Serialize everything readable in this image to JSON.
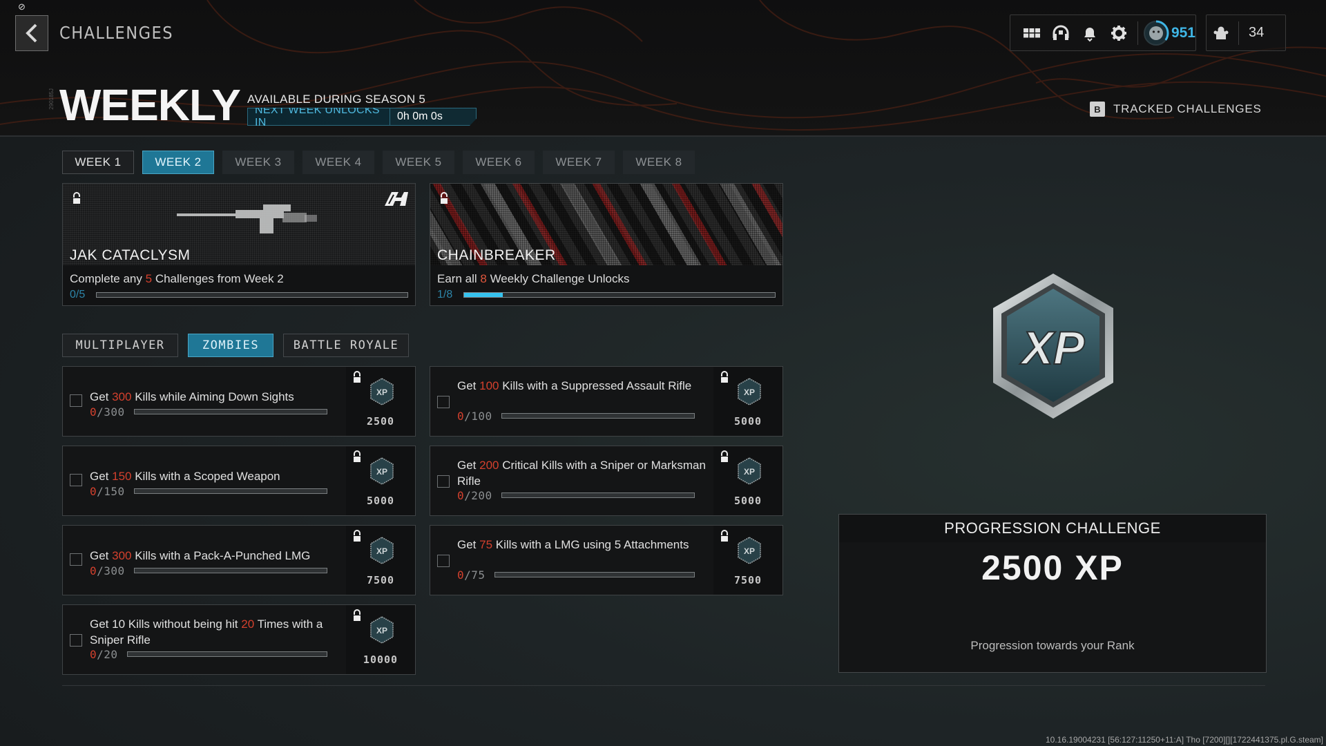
{
  "header": {
    "breadcrumb": "CHALLENGES",
    "title": "WEEKLY",
    "side_code": "290185J",
    "season": "AVAILABLE DURING SEASON 5",
    "unlock_label": "NEXT WEEK UNLOCKS IN",
    "unlock_time": "0h 0m 0s",
    "tracked_key": "B",
    "tracked_label": "TRACKED CHALLENGES"
  },
  "hud": {
    "icons": [
      "menu-grid-icon",
      "headset-icon",
      "bell-icon",
      "gear-icon"
    ],
    "rank_level": "951",
    "rank_progress": 0.35,
    "party_count": "34"
  },
  "colors": {
    "accent": "#1f7796",
    "accent_text": "#4fb9df",
    "highlight_red": "#d4402d",
    "progress_fill": "#35c3ef"
  },
  "weeks": [
    {
      "label": "WEEK 1",
      "state": "past"
    },
    {
      "label": "WEEK 2",
      "state": "active"
    },
    {
      "label": "WEEK 3",
      "state": "locked"
    },
    {
      "label": "WEEK 4",
      "state": "locked"
    },
    {
      "label": "WEEK 5",
      "state": "locked"
    },
    {
      "label": "WEEK 6",
      "state": "locked"
    },
    {
      "label": "WEEK 7",
      "state": "locked"
    },
    {
      "label": "WEEK 8",
      "state": "locked"
    }
  ],
  "rewards": [
    {
      "name": "JAK CATACLYSM",
      "desc_pre": "Complete any ",
      "desc_num": "5",
      "desc_post": " Challenges from Week 2",
      "progress_text": "0/5",
      "progress": 0.0
    },
    {
      "name": "CHAINBREAKER",
      "desc_pre": "Earn all ",
      "desc_num": "8",
      "desc_post": " Weekly Challenge Unlocks",
      "progress_text": "1/8",
      "progress": 0.125
    }
  ],
  "modes": [
    {
      "label": "MULTIPLAYER",
      "active": false
    },
    {
      "label": "ZOMBIES",
      "active": true
    },
    {
      "label": "BATTLE ROYALE",
      "active": false
    }
  ],
  "challenges": [
    {
      "pre": "Get ",
      "num": "300",
      "post": " Kills while Aiming Down Sights",
      "current": "0",
      "total": "/300",
      "progress": 0,
      "xp": "2500"
    },
    {
      "pre": "Get ",
      "num": "100",
      "post": " Kills with a Suppressed Assault Rifle",
      "current": "0",
      "total": "/100",
      "progress": 0,
      "xp": "5000"
    },
    {
      "pre": "Get ",
      "num": "150",
      "post": " Kills with a Scoped Weapon",
      "current": "0",
      "total": "/150",
      "progress": 0,
      "xp": "5000"
    },
    {
      "pre": "Get ",
      "num": "200",
      "post": " Critical Kills with a Sniper or Marksman Rifle",
      "current": "0",
      "total": "/200",
      "progress": 0,
      "xp": "5000"
    },
    {
      "pre": "Get ",
      "num": "300",
      "post": " Kills with a Pack-A-Punched LMG",
      "current": "0",
      "total": "/300",
      "progress": 0,
      "xp": "7500"
    },
    {
      "pre": "Get ",
      "num": "75",
      "post": " Kills with a LMG using 5 Attachments",
      "current": "0",
      "total": "/75",
      "progress": 0,
      "xp": "7500"
    },
    {
      "pre": "Get 10 Kills without being hit ",
      "num": "20",
      "post": " Times with a Sniper Rifle",
      "current": "0",
      "total": "/20",
      "progress": 0,
      "xp": "10000"
    }
  ],
  "progression": {
    "heading": "PROGRESSION CHALLENGE",
    "xp": "2500 XP",
    "subtitle": "Progression towards your Rank",
    "badge_text": "XP"
  },
  "footer": {
    "version": "10.16.19004231 [56:127:11250+11:A] Tho [7200][][1722441375.pl.G.steam]"
  }
}
